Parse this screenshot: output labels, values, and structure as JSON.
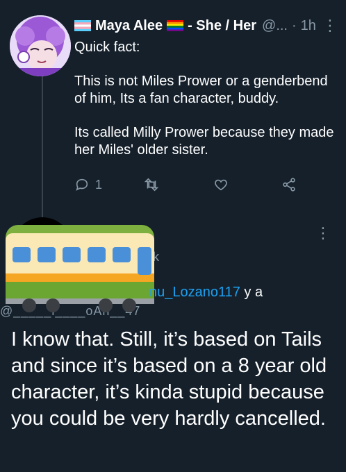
{
  "tweet": {
    "author_name": "Maya Alee",
    "pronouns": "- She / Her",
    "handle": "@...",
    "separator": "·",
    "time": "1h",
    "lines": [
      "Quick fact:",
      "This is not Miles Prower or a genderbend of him, Its a fan character, buddy.",
      "Its called Milly Prower because they made her Miles' older sister."
    ],
    "reply_count": "1",
    "colors": {
      "accent": "#1da1f2",
      "muted": "#8899a6",
      "background": "#15202b"
    }
  },
  "reply": {
    "cut_name_fragment": "k",
    "replying_to_link": "nu_Lozano117",
    "replying_to_suffix": " y a",
    "obscured_handle": "@_____l____oAn__47",
    "text": "I know that. Still, it’s based on Tails and since it’s based on a 8 year old character, it’s kinda stupid because you could be very hardly cancelled."
  },
  "icons": [
    "trans-flag-icon",
    "rainbow-flag-icon",
    "more-icon",
    "reply-icon",
    "retweet-icon",
    "like-icon",
    "share-icon",
    "train-car-emoji"
  ]
}
